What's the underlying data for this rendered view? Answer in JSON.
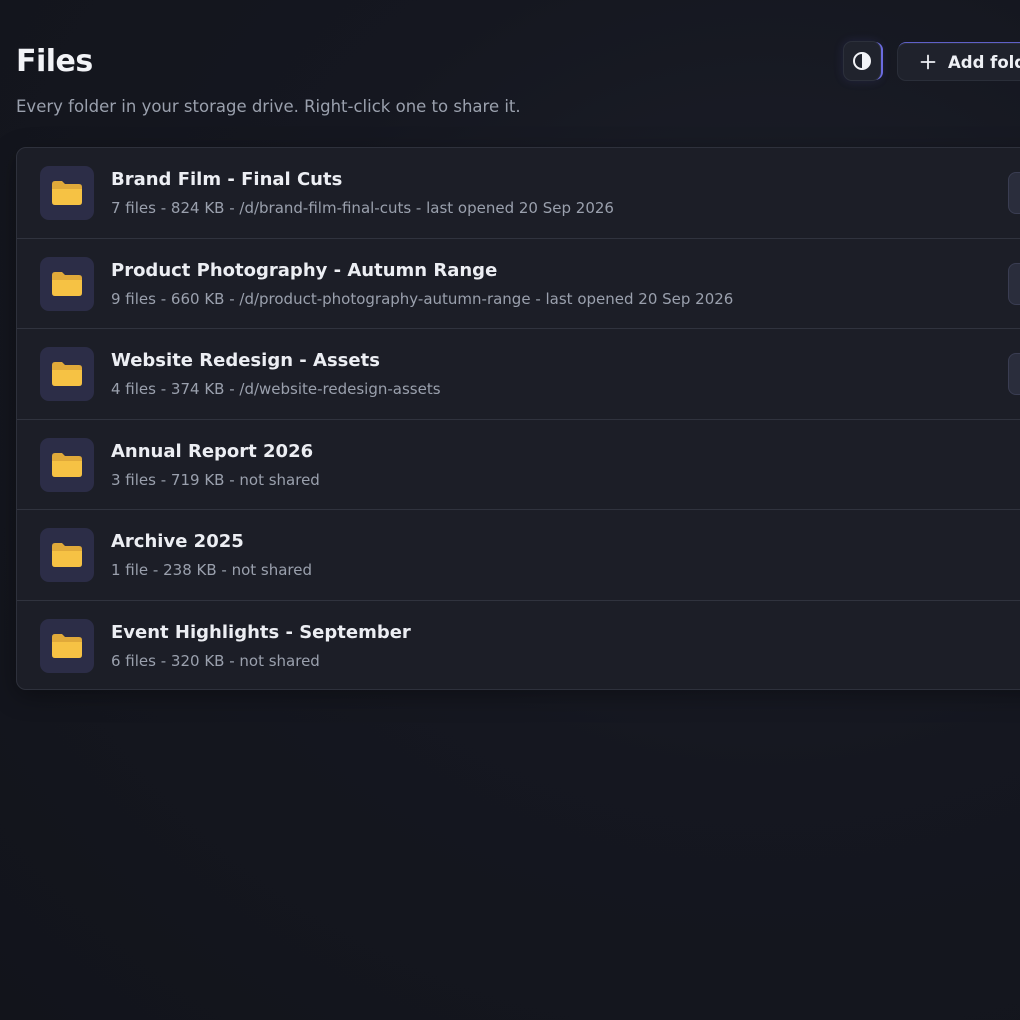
{
  "header": {
    "title": "Files",
    "subtitle": "Every folder in your storage drive. Right-click one to share it.",
    "add_folder_label": "Add folder"
  },
  "folders": [
    {
      "name": "Brand Film - Final Cuts",
      "meta": "7 files - 824 KB - /d/brand-film-final-cuts - last opened 20 Sep 2026",
      "shared": true
    },
    {
      "name": "Product Photography - Autumn Range",
      "meta": "9 files - 660 KB - /d/product-photography-autumn-range - last opened 20 Sep 2026",
      "shared": true
    },
    {
      "name": "Website Redesign - Assets",
      "meta": "4 files - 374 KB - /d/website-redesign-assets",
      "shared": true
    },
    {
      "name": "Annual Report 2026",
      "meta": "3 files - 719 KB - not shared",
      "shared": false
    },
    {
      "name": "Archive 2025",
      "meta": "1 file - 238 KB - not shared",
      "shared": false
    },
    {
      "name": "Event Highlights - September",
      "meta": "6 files - 320 KB - not shared",
      "shared": false
    }
  ],
  "icons": {
    "theme_toggle": "contrast-icon",
    "add_folder": "plus-icon",
    "folder": "folder-icon"
  },
  "colors": {
    "background": "#151720",
    "panel": "#1c1e27",
    "folder_tile": "#2c2d47",
    "folder_icon": "#f6c244",
    "accent": "#6b6be0"
  }
}
